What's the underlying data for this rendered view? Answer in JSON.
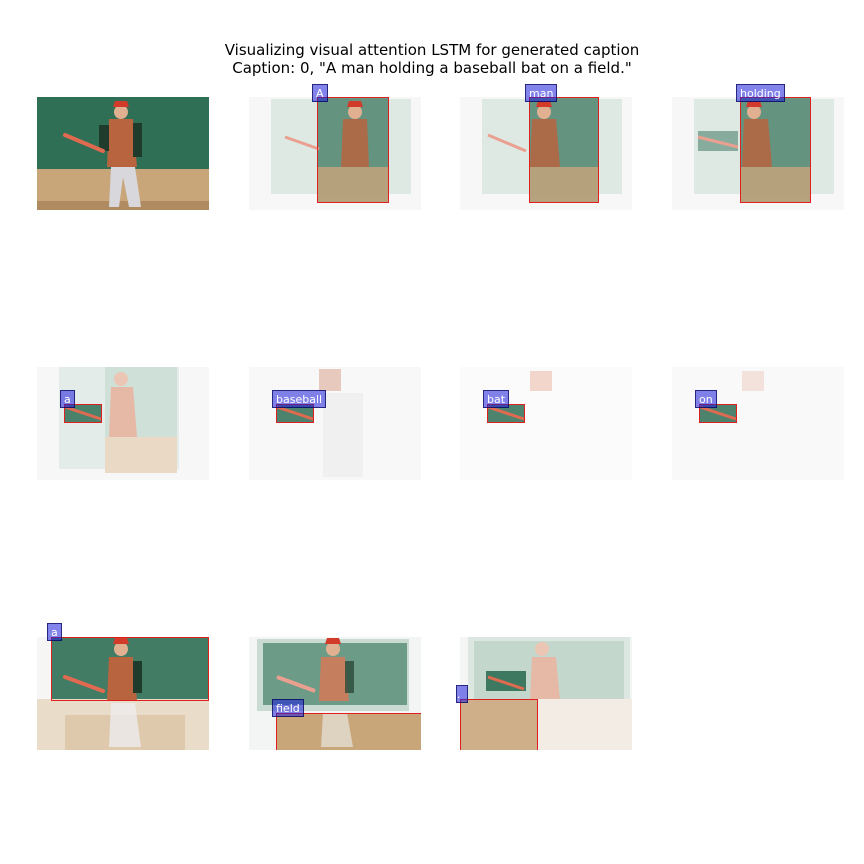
{
  "figure": {
    "title_line1": "Visualizing visual attention LSTM for generated caption",
    "title_line2": "Caption: 0, \"A man holding a baseball bat on a field.\""
  },
  "original_image": {
    "label": "original-photo"
  },
  "attention_steps": [
    {
      "word": "A"
    },
    {
      "word": "man"
    },
    {
      "word": "holding"
    },
    {
      "word": "a"
    },
    {
      "word": "baseball"
    },
    {
      "word": "bat"
    },
    {
      "word": "on"
    },
    {
      "word": "a"
    },
    {
      "word": "field"
    },
    {
      "word": "."
    }
  ],
  "colors": {
    "field_green": "#2f6f55",
    "dirt": "#c9a57a",
    "jersey": "#b8643e",
    "cap": "#d23a2a",
    "label_bg": "#4b4bdc",
    "box_border": "#e02020"
  }
}
